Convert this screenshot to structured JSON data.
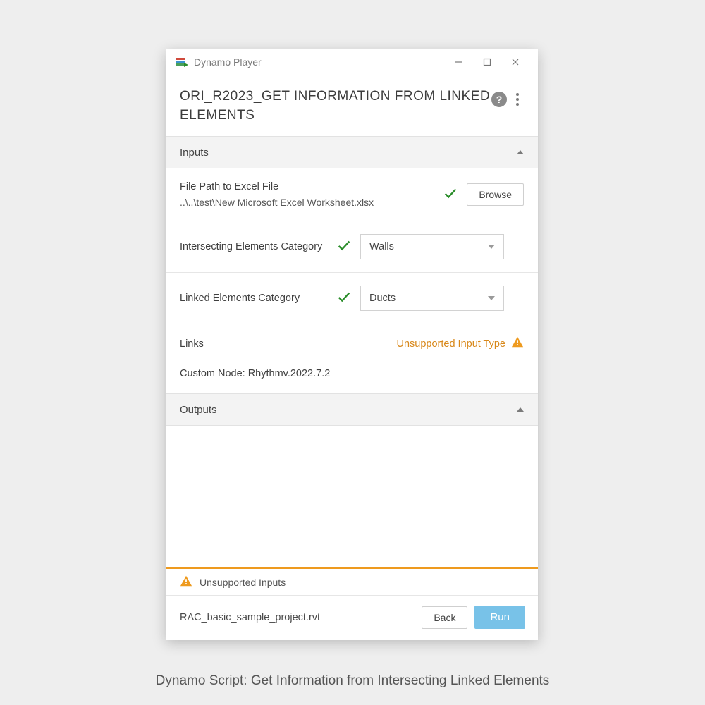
{
  "titlebar": {
    "app_title": "Dynamo Player"
  },
  "header": {
    "script_title": "ORI_R2023_GET INFORMATION FROM LINKED ELEMENTS"
  },
  "sections": {
    "inputs_label": "Inputs",
    "outputs_label": "Outputs"
  },
  "inputs": {
    "file_path": {
      "label": "File Path to Excel File",
      "value": "..\\..\\test\\New Microsoft Excel Worksheet.xlsx",
      "browse_label": "Browse"
    },
    "intersecting": {
      "label": "Intersecting Elements Category",
      "selected": "Walls"
    },
    "linked": {
      "label": "Linked Elements Category",
      "selected": "Ducts"
    },
    "links": {
      "label": "Links",
      "warning": "Unsupported Input Type",
      "custom_node": "Custom Node: Rhythmv.2022.7.2"
    }
  },
  "status_bar": {
    "unsupported": "Unsupported Inputs"
  },
  "footer": {
    "filename": "RAC_basic_sample_project.rvt",
    "back_label": "Back",
    "run_label": "Run"
  },
  "caption": "Dynamo Script: Get Information from Intersecting Linked Elements"
}
